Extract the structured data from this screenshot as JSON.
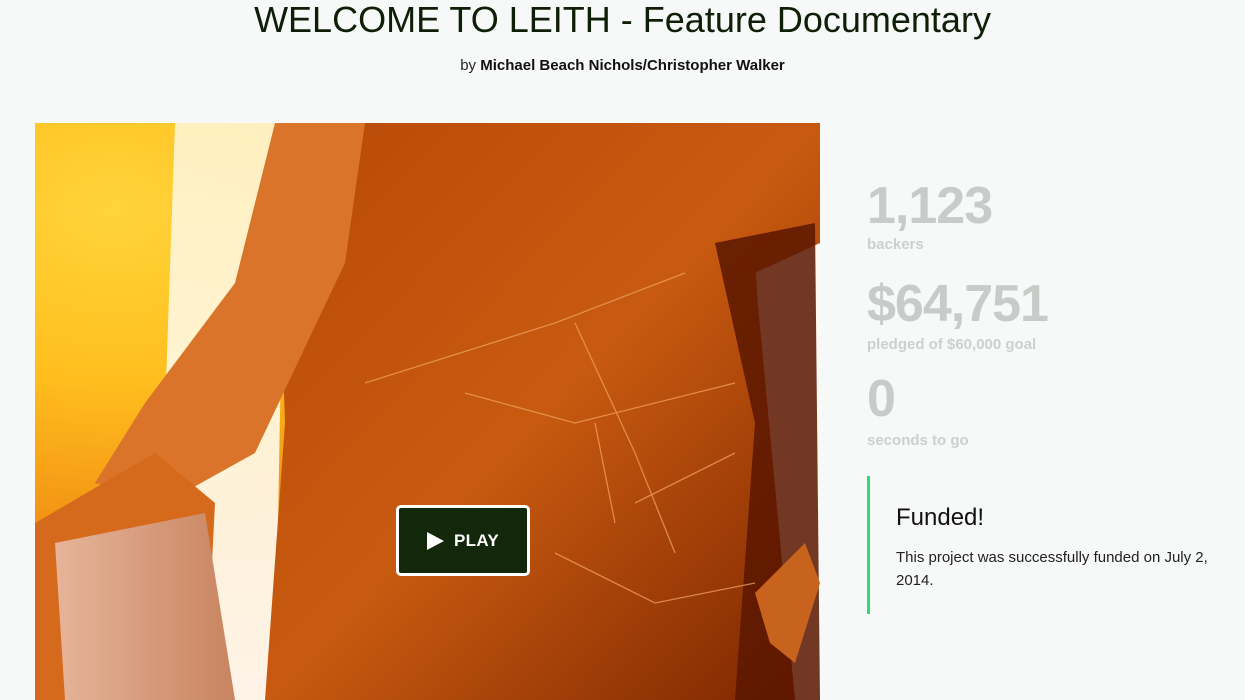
{
  "project": {
    "title": "WELCOME TO LEITH - Feature Documentary",
    "by_prefix": "by",
    "author": "Michael Beach Nichols/Christopher Walker"
  },
  "video": {
    "play_label": "PLAY",
    "play_icon": "play-icon"
  },
  "stats": {
    "backers_value": "1,123",
    "backers_label": "backers",
    "pledged_value": "$64,751",
    "pledged_label": "pledged of $60,000 goal",
    "time_value": "0",
    "time_label": "seconds to go"
  },
  "funded": {
    "title": "Funded!",
    "text": "This project was successfully funded on July 2, 2014."
  },
  "colors": {
    "background": "#f7f8f8",
    "title": "#0f1e07",
    "play_button": "#13270a",
    "stat_grey": "#c8cbc8",
    "funded_accent": "#2bde73"
  }
}
